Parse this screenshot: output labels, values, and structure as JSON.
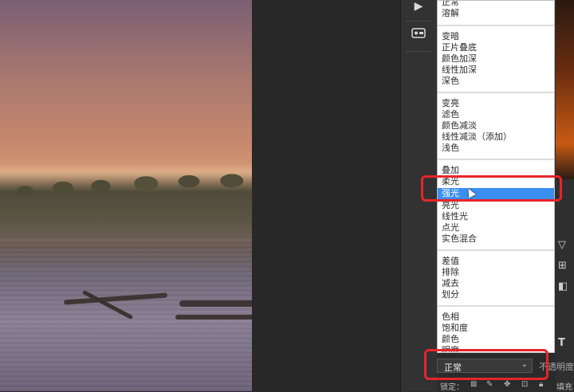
{
  "blend_modes": {
    "group1": [
      "正常",
      "溶解"
    ],
    "group2": [
      "变暗",
      "正片叠底",
      "颜色加深",
      "线性加深",
      "深色"
    ],
    "group3": [
      "变亮",
      "滤色",
      "颜色减淡",
      "线性减淡（添加）",
      "浅色"
    ],
    "group4": [
      "叠加",
      "柔光",
      "强光",
      "亮光",
      "线性光",
      "点光",
      "实色混合"
    ],
    "group5": [
      "差值",
      "排除",
      "减去",
      "划分"
    ],
    "group6": [
      "色相",
      "饱和度",
      "颜色",
      "明度"
    ],
    "selected": "强光"
  },
  "layers": {
    "mode_value": "正常",
    "opacity_label": "不透明度",
    "lock_label": "锁定：",
    "fill_label": "填充"
  },
  "tools": {
    "play_icon": "play-icon",
    "brush_settings_icon": "brush-settings-icon"
  },
  "colors": {
    "selection": "#3b8ff0",
    "highlight": "#e8252b"
  }
}
